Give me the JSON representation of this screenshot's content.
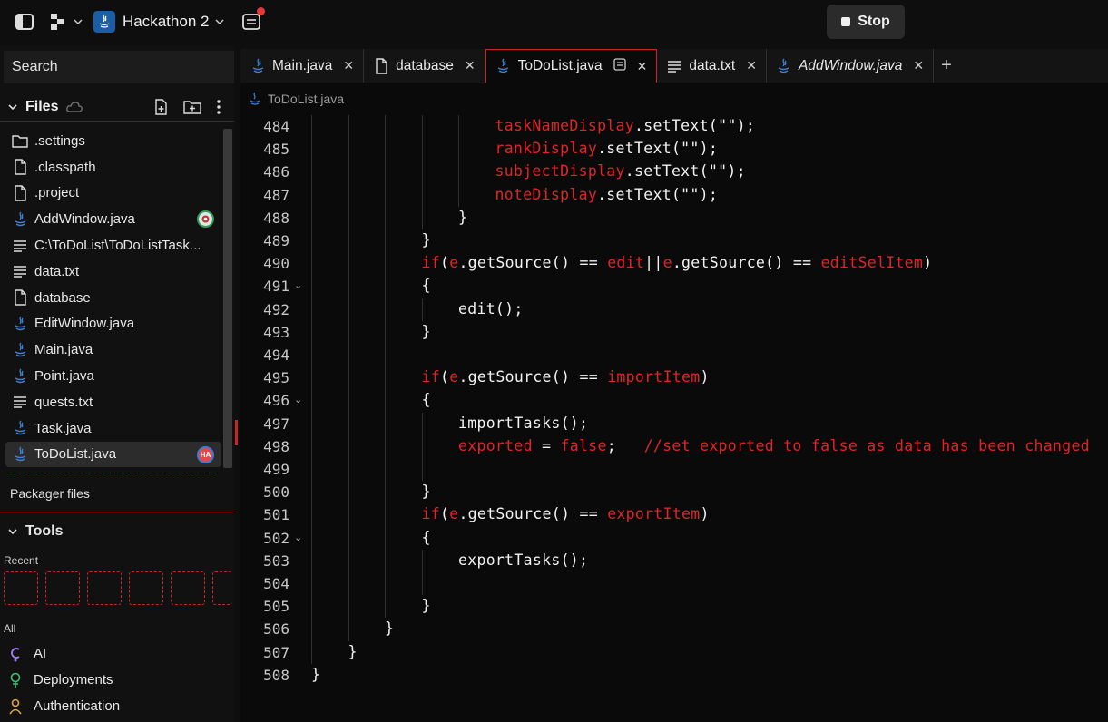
{
  "topbar": {
    "project_name": "Hackathon 2",
    "stop_label": "Stop",
    "icons": [
      "sidebar-toggle-icon",
      "workspace-logo-icon",
      "java-project-icon",
      "chevron-down-icon",
      "notifications-icon"
    ]
  },
  "sidebar": {
    "search_placeholder": "Search",
    "files_label": "Files",
    "files": [
      {
        "name": ".settings",
        "icon": "folder-icon"
      },
      {
        "name": ".classpath",
        "icon": "file-icon"
      },
      {
        "name": ".project",
        "icon": "file-icon"
      },
      {
        "name": "AddWindow.java",
        "icon": "java-file-icon",
        "badge": "green-avatar"
      },
      {
        "name": "C:\\ToDoList\\ToDoListTask...",
        "icon": "text-file-icon"
      },
      {
        "name": "data.txt",
        "icon": "text-file-icon"
      },
      {
        "name": "database",
        "icon": "file-icon"
      },
      {
        "name": "EditWindow.java",
        "icon": "java-file-icon"
      },
      {
        "name": "Main.java",
        "icon": "java-file-icon"
      },
      {
        "name": "Point.java",
        "icon": "java-file-icon"
      },
      {
        "name": "quests.txt",
        "icon": "text-file-icon"
      },
      {
        "name": "Task.java",
        "icon": "java-file-icon"
      },
      {
        "name": "ToDoList.java",
        "icon": "java-file-icon",
        "selected": true,
        "badge_text": "HA"
      }
    ],
    "packager_label": "Packager files",
    "tools_label": "Tools",
    "recent_label": "Recent",
    "all_label": "All",
    "tools": [
      {
        "name": "AI",
        "icon": "ai-icon"
      },
      {
        "name": "Deployments",
        "icon": "deployments-icon"
      },
      {
        "name": "Authentication",
        "icon": "user-icon"
      }
    ]
  },
  "tabs": [
    {
      "label": "Main.java",
      "icon": "java-file-icon"
    },
    {
      "label": "database",
      "icon": "file-icon"
    },
    {
      "label": "ToDoList.java",
      "icon": "java-file-icon",
      "active": true
    },
    {
      "label": "data.txt",
      "icon": "text-file-icon"
    },
    {
      "label": "AddWindow.java",
      "icon": "java-file-icon",
      "italic": true
    }
  ],
  "breadcrumb": "ToDoList.java",
  "code": [
    {
      "n": "484",
      "indent": 5,
      "tokens": [
        [
          "r",
          "taskNameDisplay"
        ],
        [
          "w",
          ".setText(\"\");"
        ]
      ]
    },
    {
      "n": "485",
      "indent": 5,
      "tokens": [
        [
          "r",
          "rankDisplay"
        ],
        [
          "w",
          ".setText(\"\");"
        ]
      ]
    },
    {
      "n": "486",
      "indent": 5,
      "tokens": [
        [
          "r",
          "subjectDisplay"
        ],
        [
          "w",
          ".setText(\"\");"
        ]
      ]
    },
    {
      "n": "487",
      "indent": 5,
      "tokens": [
        [
          "r",
          "noteDisplay"
        ],
        [
          "w",
          ".setText(\"\");"
        ]
      ]
    },
    {
      "n": "488",
      "indent": 4,
      "tokens": [
        [
          "w",
          "}"
        ]
      ]
    },
    {
      "n": "489",
      "indent": 3,
      "tokens": [
        [
          "w",
          "}"
        ]
      ]
    },
    {
      "n": "490",
      "indent": 3,
      "tokens": [
        [
          "r",
          "if"
        ],
        [
          "w",
          "("
        ],
        [
          "r",
          "e"
        ],
        [
          "w",
          ".getSource() == "
        ],
        [
          "r",
          "edit"
        ],
        [
          "w",
          "||"
        ],
        [
          "r",
          "e"
        ],
        [
          "w",
          ".getSource() == "
        ],
        [
          "r",
          "editSelItem"
        ],
        [
          "w",
          ")"
        ]
      ]
    },
    {
      "n": "491",
      "indent": 3,
      "fold": true,
      "tokens": [
        [
          "w",
          "{"
        ]
      ]
    },
    {
      "n": "492",
      "indent": 4,
      "tokens": [
        [
          "w",
          "edit();"
        ]
      ]
    },
    {
      "n": "493",
      "indent": 3,
      "tokens": [
        [
          "w",
          "}"
        ]
      ]
    },
    {
      "n": "494",
      "indent": 3,
      "tokens": []
    },
    {
      "n": "495",
      "indent": 3,
      "tokens": [
        [
          "r",
          "if"
        ],
        [
          "w",
          "("
        ],
        [
          "r",
          "e"
        ],
        [
          "w",
          ".getSource() == "
        ],
        [
          "r",
          "importItem"
        ],
        [
          "w",
          ")"
        ]
      ]
    },
    {
      "n": "496",
      "indent": 3,
      "fold": true,
      "tokens": [
        [
          "w",
          "{"
        ]
      ]
    },
    {
      "n": "497",
      "indent": 4,
      "tokens": [
        [
          "w",
          "importTasks();"
        ]
      ]
    },
    {
      "n": "498",
      "indent": 4,
      "tokens": [
        [
          "r",
          "exported"
        ],
        [
          "w",
          " = "
        ],
        [
          "r",
          "false"
        ],
        [
          "w",
          ";   "
        ],
        [
          "r",
          "//set exported to false as data has been changed"
        ]
      ]
    },
    {
      "n": "499",
      "indent": 4,
      "tokens": []
    },
    {
      "n": "500",
      "indent": 3,
      "tokens": [
        [
          "w",
          "}"
        ]
      ]
    },
    {
      "n": "501",
      "indent": 3,
      "tokens": [
        [
          "r",
          "if"
        ],
        [
          "w",
          "("
        ],
        [
          "r",
          "e"
        ],
        [
          "w",
          ".getSource() == "
        ],
        [
          "r",
          "exportItem"
        ],
        [
          "w",
          ")"
        ]
      ]
    },
    {
      "n": "502",
      "indent": 3,
      "fold": true,
      "tokens": [
        [
          "w",
          "{"
        ]
      ]
    },
    {
      "n": "503",
      "indent": 4,
      "tokens": [
        [
          "w",
          "exportTasks();"
        ]
      ]
    },
    {
      "n": "504",
      "indent": 4,
      "tokens": []
    },
    {
      "n": "505",
      "indent": 3,
      "tokens": [
        [
          "w",
          "}"
        ]
      ]
    },
    {
      "n": "506",
      "indent": 2,
      "tokens": [
        [
          "w",
          "}"
        ]
      ]
    },
    {
      "n": "507",
      "indent": 1,
      "tokens": [
        [
          "w",
          "}"
        ]
      ]
    },
    {
      "n": "508",
      "indent": 0,
      "tokens": [
        [
          "w",
          "}"
        ]
      ]
    }
  ],
  "colors": {
    "accent_red": "#e02525",
    "java_blue": "#1b5ea8",
    "stop_bg": "#2b2b2b"
  }
}
